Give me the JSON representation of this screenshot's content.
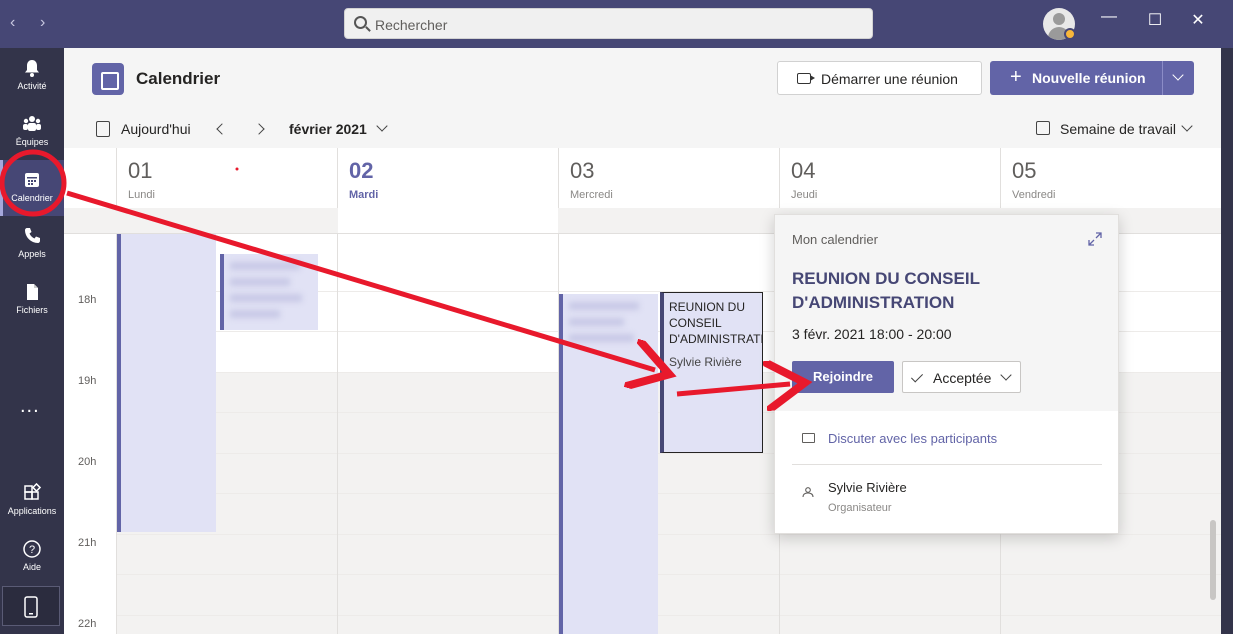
{
  "titlebar": {
    "search_placeholder": "Rechercher",
    "back_arrow": "‹",
    "forward_arrow": "›",
    "minimize": "—",
    "maximize": "☐",
    "close": "✕"
  },
  "rail": {
    "items": [
      {
        "label": "Activité",
        "icon": "bell-icon"
      },
      {
        "label": "Équipes",
        "icon": "teams-icon"
      },
      {
        "label": "Calendrier",
        "icon": "calendar-icon",
        "active": true
      },
      {
        "label": "Appels",
        "icon": "phone-icon"
      },
      {
        "label": "Fichiers",
        "icon": "file-icon"
      },
      {
        "label": "Applications",
        "icon": "apps-icon"
      },
      {
        "label": "Aide",
        "icon": "help-icon"
      }
    ],
    "more": "..."
  },
  "header": {
    "title": "Calendrier",
    "start_meeting": "Démarrer une réunion",
    "new_meeting": "Nouvelle réunion",
    "plus": "+"
  },
  "toolbar": {
    "today": "Aujourd'hui",
    "month": "février 2021",
    "view": "Semaine de travail"
  },
  "days": [
    {
      "num": "01",
      "name": "Lundi"
    },
    {
      "num": "02",
      "name": "Mardi",
      "today": true
    },
    {
      "num": "03",
      "name": "Mercredi"
    },
    {
      "num": "04",
      "name": "Jeudi"
    },
    {
      "num": "05",
      "name": "Vendredi"
    }
  ],
  "hours": [
    "18h",
    "19h",
    "20h",
    "21h",
    "22h"
  ],
  "event": {
    "title_line1": "REUNION DU",
    "title_line2": "CONSEIL",
    "title_line3": "D'ADMINISTRATI",
    "organizer": "Sylvie Rivière"
  },
  "popup": {
    "calendar": "Mon calendrier",
    "title": "REUNION DU CONSEIL D'ADMINISTRATION",
    "datetime": "3 févr. 2021 18:00 - 20:00",
    "join": "Rejoindre",
    "accepted": "Acceptée",
    "chat": "Discuter avec les participants",
    "organizer_name": "Sylvie Rivière",
    "organizer_role": "Organisateur"
  },
  "colors": {
    "brand": "#6264a7",
    "titlebar": "#464775",
    "rail": "#33344a",
    "annotation": "#e8192c"
  }
}
